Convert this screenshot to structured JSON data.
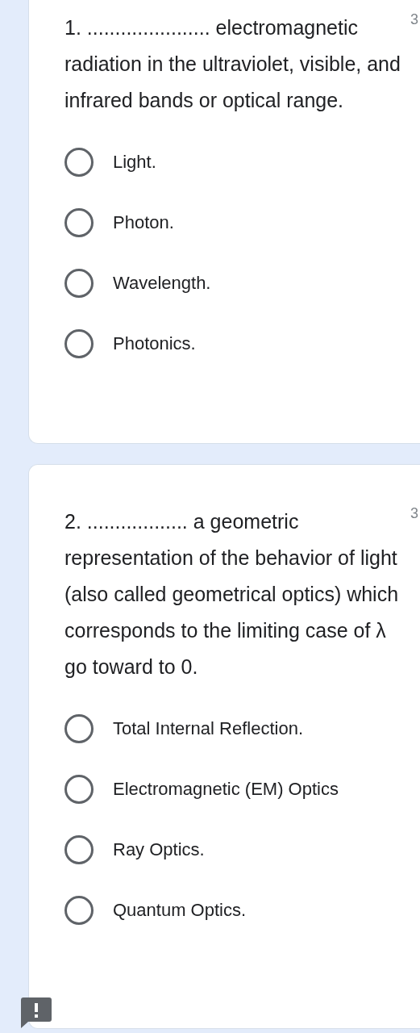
{
  "questions": [
    {
      "text": "1. ...................... electromagnetic radiation in the ultraviolet, visible, and infrared bands or optical range.",
      "points": "3",
      "options": [
        {
          "label": "Light.",
          "selected": false
        },
        {
          "label": "Photon.",
          "selected": false
        },
        {
          "label": "Wavelength.",
          "selected": false
        },
        {
          "label": "Photonics.",
          "selected": false
        }
      ]
    },
    {
      "text": "2. .................. a geometric representation of the behavior of light (also called geometrical optics) which corresponds to the limiting case of λ go toward to 0.",
      "points": "3",
      "options": [
        {
          "label": "Total Internal Reflection.",
          "selected": false
        },
        {
          "label": "Electromagnetic (EM) Optics",
          "selected": false
        },
        {
          "label": "Ray Optics.",
          "selected": false
        },
        {
          "label": "Quantum Optics.",
          "selected": false
        }
      ]
    }
  ]
}
